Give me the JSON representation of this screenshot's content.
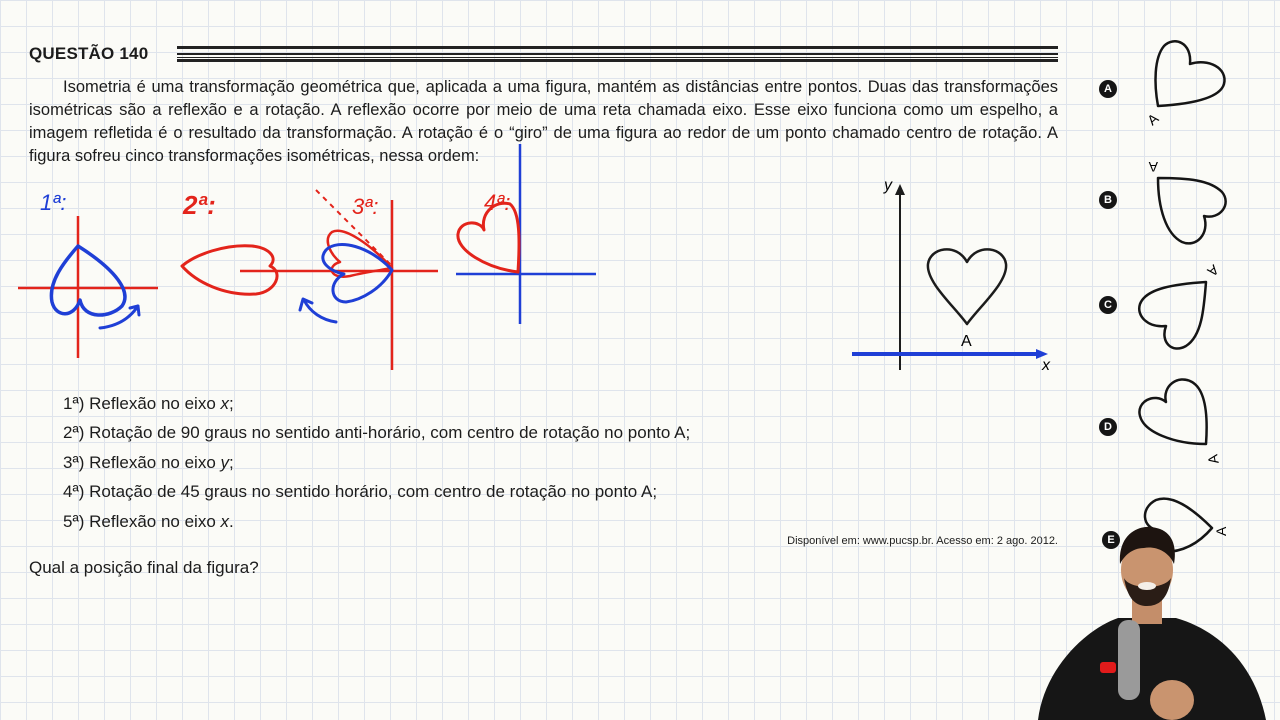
{
  "question": {
    "title": "QUESTÃO 140",
    "intro": "Isometria é uma transformação geométrica que, aplicada a uma figura, mantém as distâncias entre pontos. Duas das transformações isométricas são a reflexão e a rotação. A reflexão ocorre por meio de uma reta chamada eixo. Esse eixo funciona como um espelho, a imagem refletida é o resultado da transformação. A rotação é o “giro” de uma figura ao redor de um ponto chamado centro de rotação. A figura sofreu cinco transformações isométricas, nessa ordem:",
    "steps": [
      {
        "prefix": "1ª) Reflexão no eixo ",
        "axis": "x",
        "suffix": ";"
      },
      {
        "prefix": "2ª) Rotação de 90 graus no sentido anti-horário, com centro de rotação no ponto A;",
        "axis": "",
        "suffix": ""
      },
      {
        "prefix": "3ª) Reflexão no eixo ",
        "axis": "y",
        "suffix": ";"
      },
      {
        "prefix": "4ª) Rotação de 45 graus no sentido horário, com centro de rotação no ponto A;",
        "axis": "",
        "suffix": ""
      },
      {
        "prefix": "5ª) Reflexão no eixo ",
        "axis": "x",
        "suffix": "."
      }
    ],
    "source": "Disponível em: www.pucsp.br. Acesso em: 2 ago. 2012.",
    "prompt": "Qual a posição final da figura?"
  },
  "figure": {
    "y_label": "y",
    "x_label": "x",
    "point_label": "A"
  },
  "annotations": {
    "step1": "1ª:",
    "step2": "2ª:",
    "step3": "3ª:",
    "step4": "4ª:",
    "colors": {
      "blue": "#1f3fd6",
      "red": "#e3241b"
    }
  },
  "options": [
    {
      "letter": "A",
      "point": "A"
    },
    {
      "letter": "B",
      "point": "A"
    },
    {
      "letter": "C",
      "point": "A"
    },
    {
      "letter": "D",
      "point": "A"
    },
    {
      "letter": "E",
      "point": "A"
    }
  ]
}
